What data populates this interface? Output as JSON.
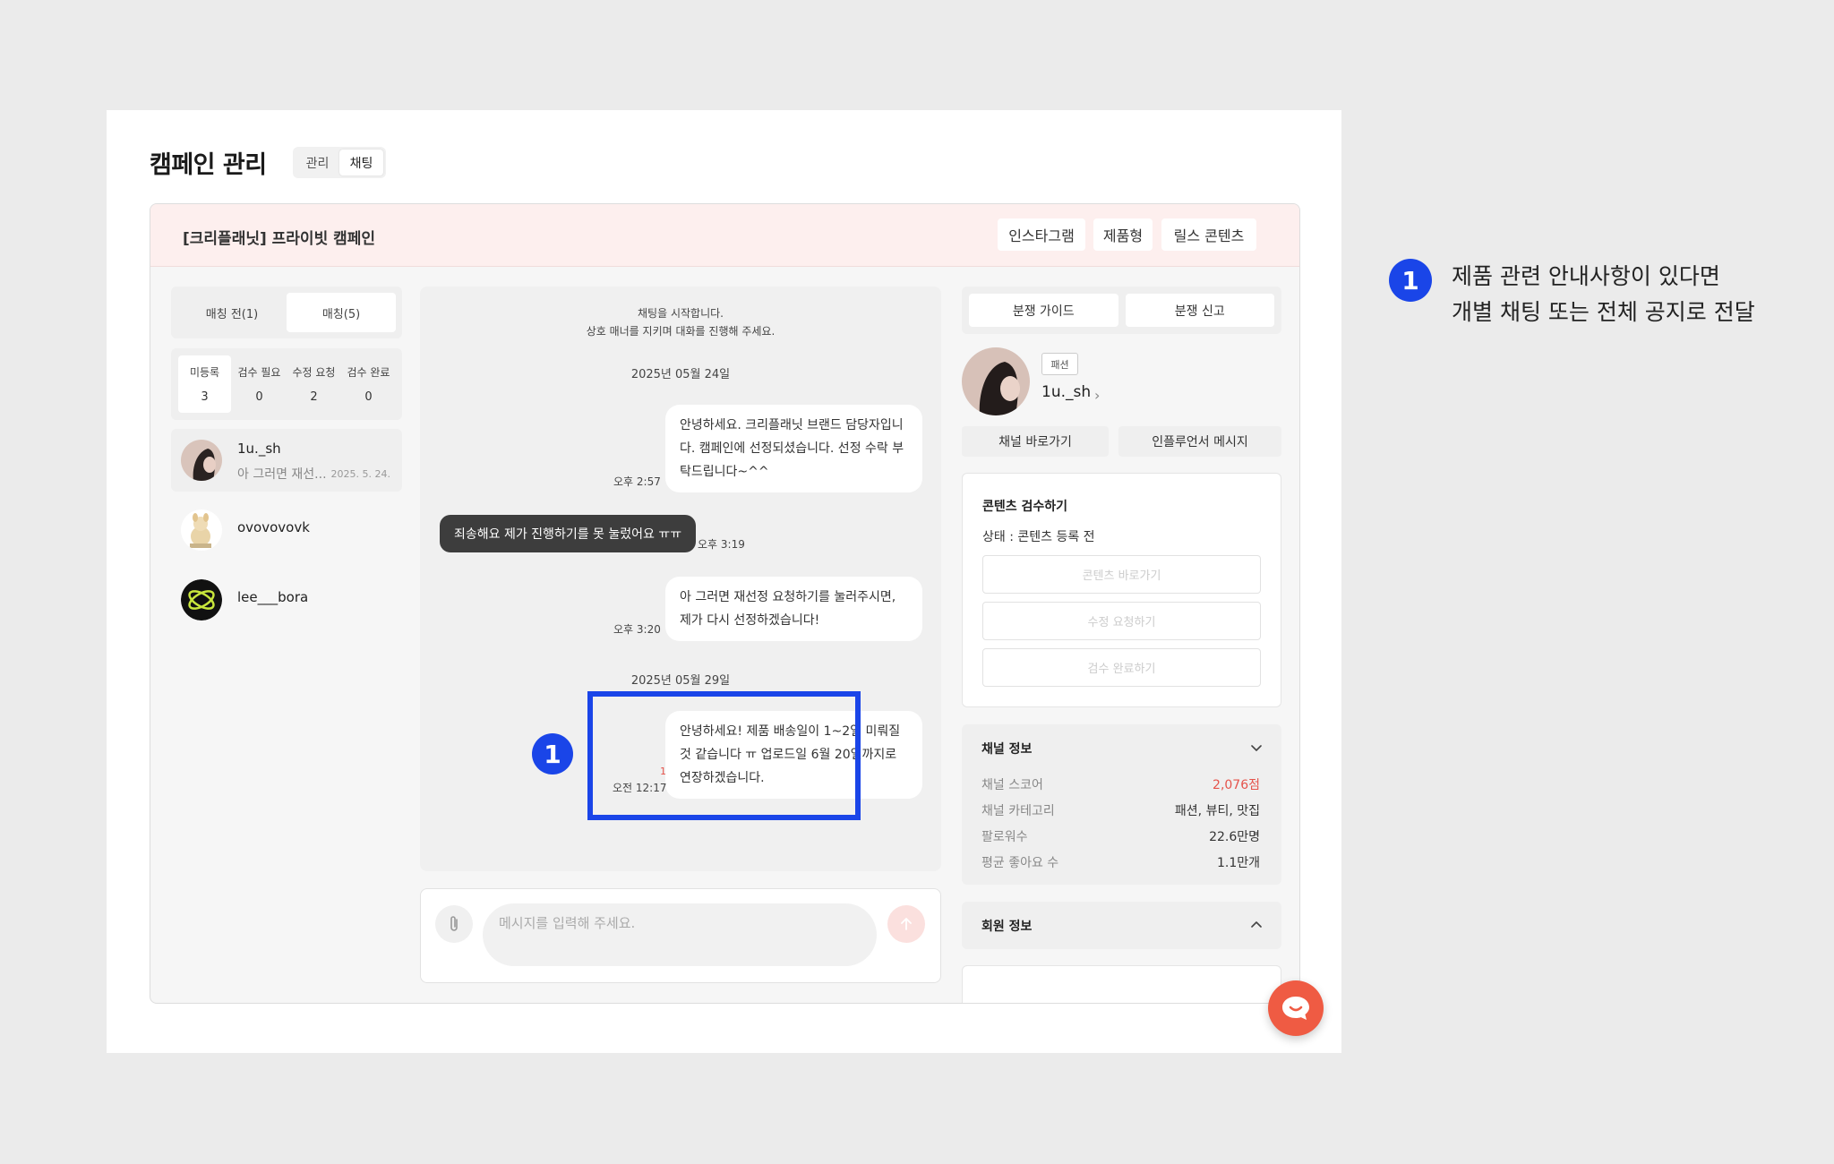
{
  "page": {
    "title": "캠페인 관리",
    "tabs": [
      "관리",
      "채팅"
    ]
  },
  "campaign": {
    "name": "[크리플래닛] 프라이빗 캠페인",
    "tags": [
      "인스타그램",
      "제품형",
      "릴스 콘텐츠"
    ]
  },
  "left_panel": {
    "tabs": [
      "매칭 전(1)",
      "매칭(5)"
    ],
    "stats": [
      {
        "label": "미등록",
        "value": "3"
      },
      {
        "label": "검수 필요",
        "value": "0"
      },
      {
        "label": "수정 요청",
        "value": "2"
      },
      {
        "label": "검수 완료",
        "value": "0"
      }
    ],
    "users": [
      {
        "name": "1u._sh",
        "preview": "아 그러면 재선...",
        "date": "2025. 5. 24."
      },
      {
        "name": "ovovovovk"
      },
      {
        "name": "lee___bora"
      }
    ]
  },
  "chat": {
    "system_line1": "채팅을 시작합니다.",
    "system_line2": "상호 매너를 지키며 대화를 진행해 주세요.",
    "date1": "2025년 05월 24일",
    "msg1": {
      "text": "안녕하세요. 크리플래닛 브랜드 담당자입니다. 캠페인에 선정되셨습니다. 선정 수락 부탁드립니다~^^",
      "time": "오후 2:57"
    },
    "msg2": {
      "text": "죄송해요 제가 진행하기를 못 눌렀어요 ㅠㅠ",
      "time": "오후 3:19"
    },
    "msg3": {
      "text": "아 그러면 재선정 요청하기를 눌러주시면, 제가 다시 선정하겠습니다!",
      "time": "오후 3:20"
    },
    "date2": "2025년 05월 29일",
    "msg4": {
      "text": "안녕하세요! 제품 배송일이 1~2일 미뤄질 것 같습니다 ㅠ 업로드일 6월 20일까지로 연장하겠습니다.",
      "time": "오전 12:17",
      "unread": "1"
    },
    "marker": "1",
    "input_placeholder": "메시지를 입력해 주세요."
  },
  "right_panel": {
    "tabs": [
      "분쟁 가이드",
      "분쟁 신고"
    ],
    "profile": {
      "category": "패션",
      "name": "1u._sh"
    },
    "buttons": [
      "채널 바로가기",
      "인플루언서 메시지"
    ],
    "content_review": {
      "title": "콘텐츠 검수하기",
      "status": "상태 : 콘텐츠 등록 전",
      "buttons": [
        "콘텐츠 바로가기",
        "수정 요청하기",
        "검수 완료하기"
      ]
    },
    "channel_info": {
      "title": "채널 정보",
      "rows": [
        {
          "key": "채널 스코어",
          "value": "2,076점"
        },
        {
          "key": "채널 카테고리",
          "value": "패션, 뷰티, 맛집"
        },
        {
          "key": "팔로워수",
          "value": "22.6만명"
        },
        {
          "key": "평균 좋아요 수",
          "value": "1.1만개"
        }
      ]
    },
    "member_info": {
      "title": "회원 정보"
    }
  },
  "annotation": {
    "number": "1",
    "line1": "제품 관련 안내사항이 있다면",
    "line2": "개별 채팅 또는 전체 공지로 전달"
  },
  "colors": {
    "accent_blue": "#1a45e8",
    "brand_red": "#ef5b43",
    "score_red": "#e5534b",
    "header_pink": "#fdefee"
  }
}
